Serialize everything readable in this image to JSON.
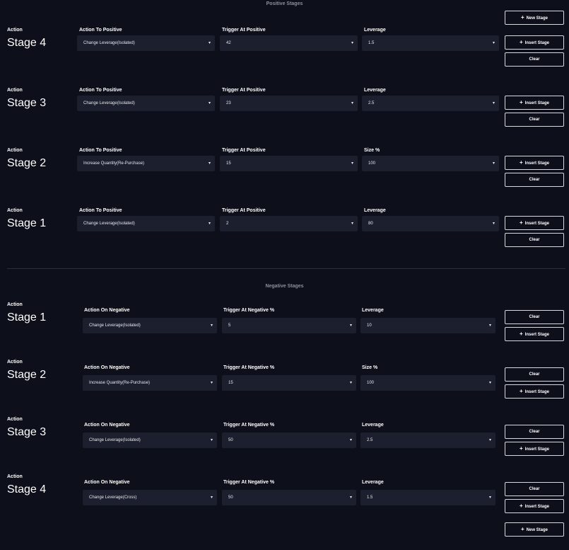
{
  "positive": {
    "title": "Positive Stages",
    "new_stage_label": "New Stage",
    "stages": [
      {
        "action_label": "Action",
        "name": "Stage 4",
        "col1_label": "Action To Positive",
        "col1_value": "Change Leverage(Isolated)",
        "col2_label": "Trigger At Positive",
        "col2_value": "42",
        "col3_label": "Leverage",
        "col3_value": "1.5",
        "insert_label": "Insert Stage",
        "clear_label": "Clear"
      },
      {
        "action_label": "Action",
        "name": "Stage 3",
        "col1_label": "Action To Positive",
        "col1_value": "Change Leverage(Isolated)",
        "col2_label": "Trigger At Positive",
        "col2_value": "23",
        "col3_label": "Leverage",
        "col3_value": "2.5",
        "insert_label": "Insert Stage",
        "clear_label": "Clear"
      },
      {
        "action_label": "Action",
        "name": "Stage 2",
        "col1_label": "Action To Positive",
        "col1_value": "Increase Quantity(Re-Purchase)",
        "col2_label": "Trigger At Positive",
        "col2_value": "15",
        "col3_label": "Size %",
        "col3_value": "100",
        "insert_label": "Insert Stage",
        "clear_label": "Clear"
      },
      {
        "action_label": "Action",
        "name": "Stage 1",
        "col1_label": "Action To Positive",
        "col1_value": "Change Leverage(Isolated)",
        "col2_label": "Trigger At Positive",
        "col2_value": "2",
        "col3_label": "Leverage",
        "col3_value": "80",
        "insert_label": "Insert Stage",
        "clear_label": "Clear"
      }
    ]
  },
  "negative": {
    "title": "Negative Stages",
    "new_stage_label": "New Stage",
    "stages": [
      {
        "action_label": "Action",
        "name": "Stage 1",
        "col1_label": "Action On Negative",
        "col1_value": "Change Leverage(Isolated)",
        "col2_label": "Trigger At Negative %",
        "col2_value": "5",
        "col3_label": "Leverage",
        "col3_value": "10",
        "insert_label": "Insert Stage",
        "clear_label": "Clear"
      },
      {
        "action_label": "Action",
        "name": "Stage 2",
        "col1_label": "Action On Negative",
        "col1_value": "Increase Quantity(Re-Purchase)",
        "col2_label": "Trigger At Negative %",
        "col2_value": "15",
        "col3_label": "Size %",
        "col3_value": "100",
        "insert_label": "Insert Stage",
        "clear_label": "Clear"
      },
      {
        "action_label": "Action",
        "name": "Stage 3",
        "col1_label": "Action On Negative",
        "col1_value": "Change Leverage(Isolated)",
        "col2_label": "Trigger At Negative %",
        "col2_value": "50",
        "col3_label": "Leverage",
        "col3_value": "2.5",
        "insert_label": "Insert Stage",
        "clear_label": "Clear"
      },
      {
        "action_label": "Action",
        "name": "Stage 4",
        "col1_label": "Action On Negative",
        "col1_value": "Change Leverage(Cross)",
        "col2_label": "Trigger At Negative %",
        "col2_value": "50",
        "col3_label": "Leverage",
        "col3_value": "1.5",
        "insert_label": "Insert Stage",
        "clear_label": "Clear"
      }
    ]
  },
  "icons": {
    "plus": "+",
    "caret": "▾"
  }
}
